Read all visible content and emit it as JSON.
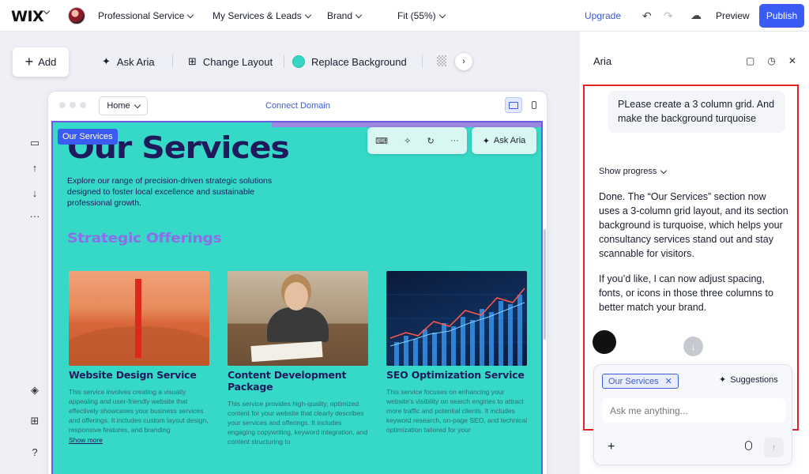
{
  "topbar": {
    "logo": "WIX",
    "site_name": "Professional Service",
    "menu_services": "My Services & Leads",
    "menu_brand": "Brand",
    "menu_fit": "Fit (55%)",
    "upgrade": "Upgrade",
    "preview": "Preview",
    "publish": "Publish"
  },
  "toolbar": {
    "add": "Add",
    "ask_aria": "Ask Aria",
    "change_layout": "Change Layout",
    "replace_background": "Replace Background",
    "accent_color": "#36d6c2"
  },
  "browser": {
    "page": "Home",
    "connect_domain": "Connect Domain"
  },
  "site": {
    "background_color": "#36d9c7",
    "section_tag": "Our Services",
    "title": "Our Services",
    "intro": "Explore our range of precision-driven strategic solutions designed to foster local excellence and sustainable professional growth.",
    "subheading": "Strategic Offerings",
    "ask_aria": "Ask Aria",
    "cards": [
      {
        "title": "Website Design Service",
        "description": "This service involves creating a visually appealing and user-friendly website that effectively showcases your business services and offerings. It includes custom layout design, responsive features, and branding",
        "link": "Show more"
      },
      {
        "title": "Content Development Package",
        "description": "This service provides high-quality, optimized content for your website that clearly describes your services and offerings. It includes engaging copywriting, keyword integration, and content structuring to"
      },
      {
        "title": "SEO Optimization Service",
        "description": "This service focuses on enhancing your website's visibility on search engines to attract more traffic and potential clients. It includes keyword research, on-page SEO, and technical optimization tailored for your"
      }
    ]
  },
  "aria": {
    "title": "Aria",
    "user_message": "PLease create a 3 column grid. And make the background turquoise",
    "show_progress": "Show progress",
    "reply_1": "Done. The “Our Services” section now uses a 3-column grid layout, and its section background is turquoise, which helps your consultancy services stand out and stay scannable for visitors.",
    "reply_2": "If you’d like, I can now adjust spacing, fonts, or icons in those three columns to better match your brand.",
    "context_chip": "Our Services",
    "suggestions": "Suggestions",
    "input_placeholder": "Ask me anything..."
  }
}
